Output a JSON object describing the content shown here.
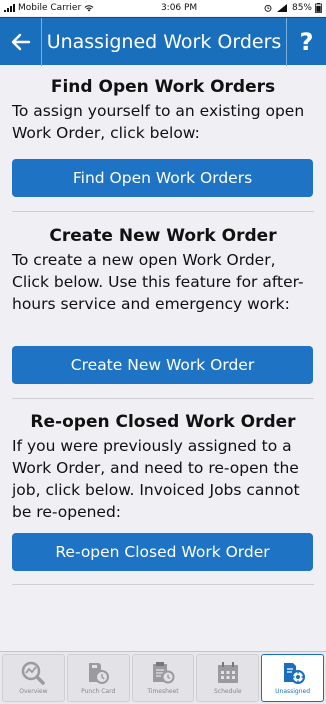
{
  "status_bar": {
    "carrier": "Mobile Carrier",
    "time": "3:06 PM",
    "battery": "85%"
  },
  "nav": {
    "title": "Unassigned Work Orders",
    "help_label": "?"
  },
  "sections": [
    {
      "title": "Find Open Work Orders",
      "description": "To assign yourself to an existing open Work Order, click below:",
      "button_label": "Find Open Work Orders"
    },
    {
      "title": "Create New Work Order",
      "description": "To create a new open Work Order, Click below. Use this feature for after-hours service and emergency work:",
      "button_label": "Create New Work Order"
    },
    {
      "title": "Re-open Closed Work Order",
      "description": "If you were previously assigned to a Work Order, and need to re-open the job, click below.  Invoiced Jobs cannot be re-opened:",
      "button_label": "Re-open Closed Work Order"
    }
  ],
  "tabs": [
    {
      "label": "Overview",
      "icon": "overview-icon",
      "active": false
    },
    {
      "label": "Punch Card",
      "icon": "punch-card-icon",
      "active": false
    },
    {
      "label": "Timesheet",
      "icon": "timesheet-icon",
      "active": false
    },
    {
      "label": "Schedule",
      "icon": "schedule-icon",
      "active": false
    },
    {
      "label": "Unassigned",
      "icon": "unassigned-icon",
      "active": true
    }
  ],
  "colors": {
    "primary": "#1a6fbd",
    "button": "#1e73c4",
    "background": "#efeff4"
  }
}
